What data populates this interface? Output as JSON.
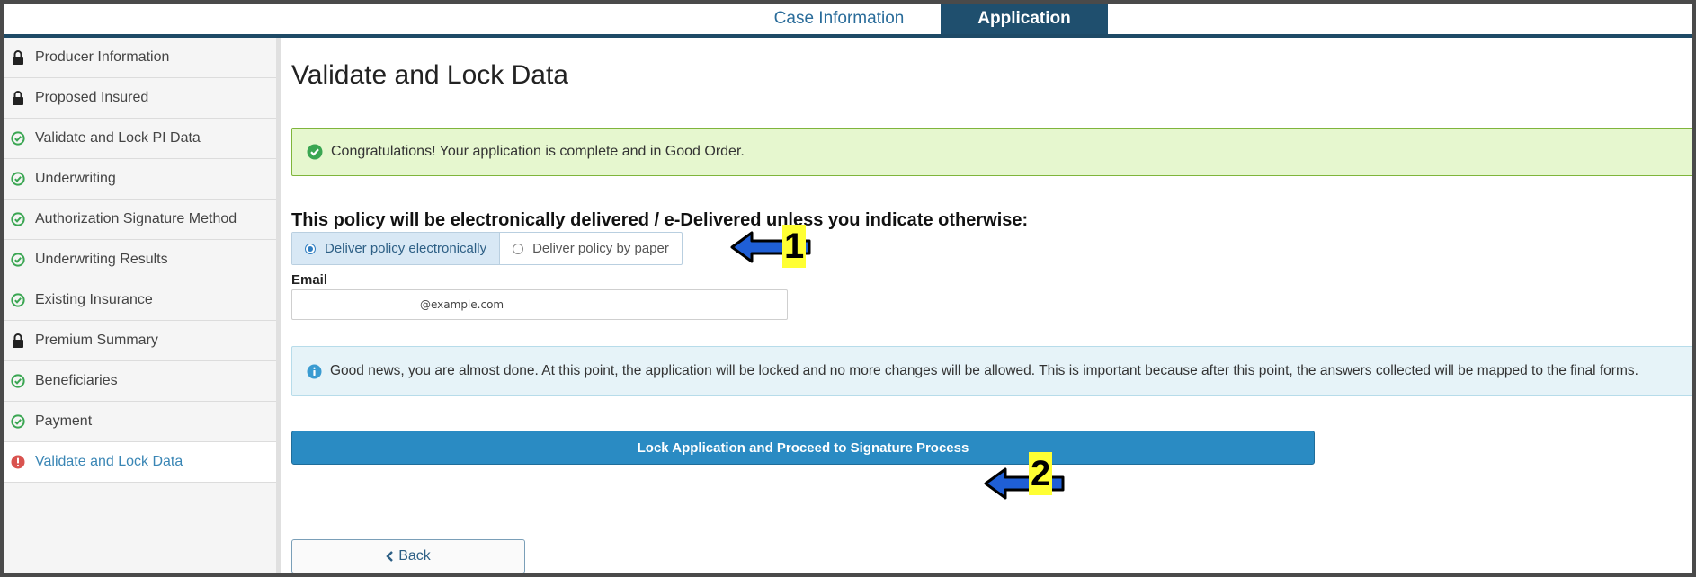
{
  "tabs": [
    {
      "label": "Case Information",
      "active": false
    },
    {
      "label": "Application",
      "active": true
    }
  ],
  "sidebar": {
    "items": [
      {
        "label": "Producer Information",
        "status_icon": "lock-icon"
      },
      {
        "label": "Proposed Insured",
        "status_icon": "lock-icon"
      },
      {
        "label": "Validate and Lock PI Data",
        "status_icon": "check-circle-icon"
      },
      {
        "label": "Underwriting",
        "status_icon": "check-circle-icon"
      },
      {
        "label": "Authorization Signature Method",
        "status_icon": "check-circle-icon"
      },
      {
        "label": "Underwriting Results",
        "status_icon": "check-circle-icon"
      },
      {
        "label": "Existing Insurance",
        "status_icon": "check-circle-icon"
      },
      {
        "label": "Premium Summary",
        "status_icon": "lock-icon"
      },
      {
        "label": "Beneficiaries",
        "status_icon": "check-circle-icon"
      },
      {
        "label": "Payment",
        "status_icon": "check-circle-icon"
      },
      {
        "label": "Validate and Lock Data",
        "status_icon": "exclamation-circle-icon",
        "active": true
      }
    ]
  },
  "main": {
    "title": "Validate and Lock Data",
    "success_alert": "Congratulations! Your application is complete and in Good Order.",
    "delivery_question": "This policy will be electronically delivered / e-Delivered unless you indicate otherwise:",
    "delivery_options": [
      {
        "label": "Deliver policy electronically",
        "selected": true
      },
      {
        "label": "Deliver policy by paper",
        "selected": false
      }
    ],
    "email_label": "Email",
    "email_value": "@example.com",
    "info_alert": "Good news, you are almost done. At this point, the application will be locked and no more changes will be allowed. This is important because after this point, the answers collected will be mapped to the final forms.",
    "lock_button": "Lock Application and Proceed to Signature Process",
    "back_button": "Back"
  },
  "annotations": [
    {
      "number": "1"
    },
    {
      "number": "2"
    }
  ],
  "colors": {
    "tab_active_bg": "#1f4f6e",
    "success_bg": "#e6f7cf",
    "info_bg": "#e6f3f8",
    "primary_button": "#2a8bc3",
    "check_green": "#3aa652",
    "error_red": "#d9534f",
    "annotation_arrow": "#1f5fd6",
    "annotation_label_bg": "#ffff33"
  }
}
